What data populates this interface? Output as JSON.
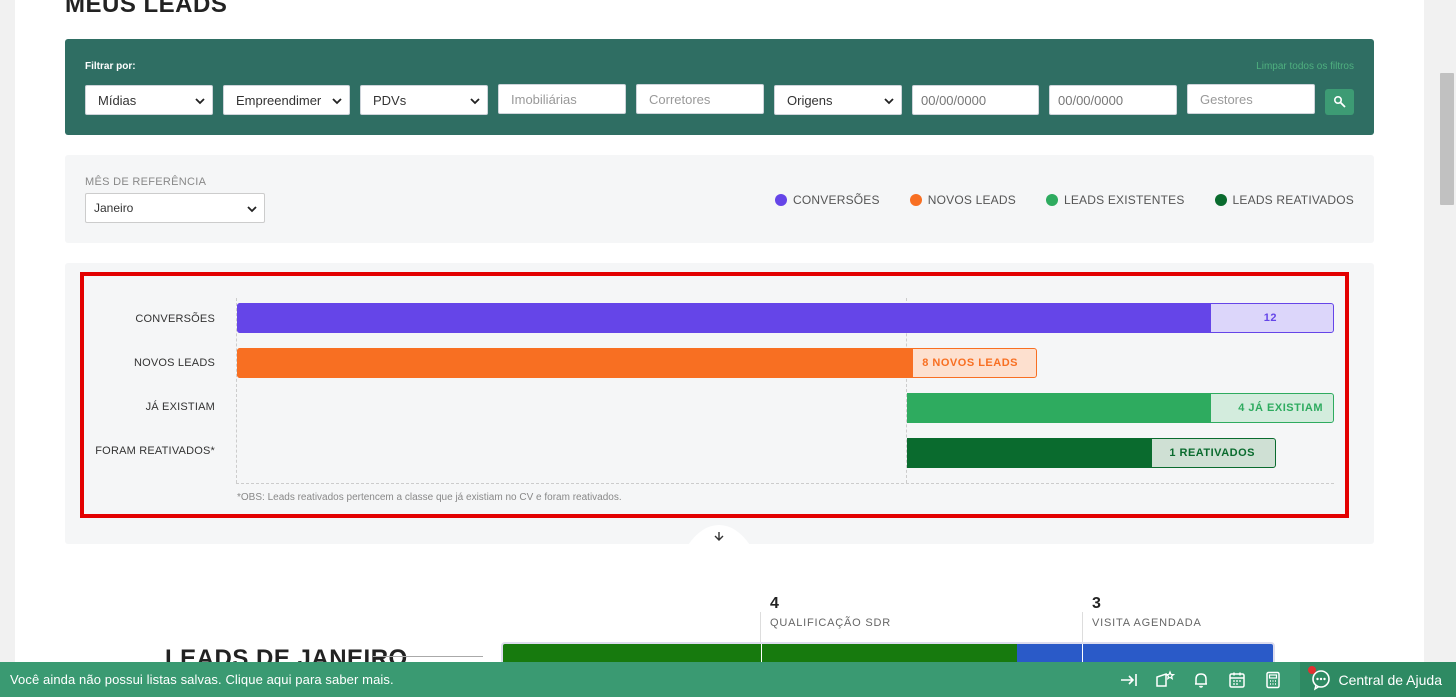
{
  "page": {
    "title": "MEUS LEADS"
  },
  "filters": {
    "label": "Filtrar por:",
    "clear_label": "Limpar todos os filtros",
    "midias": "Mídias",
    "empreendimentos": "Empreendimer",
    "pdvs": "PDVs",
    "imobiliarias_placeholder": "Imobiliárias",
    "corretores_placeholder": "Corretores",
    "origens": "Origens",
    "date_start_placeholder": "00/00/0000",
    "date_end_placeholder": "00/00/0000",
    "gestores_placeholder": "Gestores"
  },
  "reference": {
    "label": "MÊS DE REFERÊNCIA",
    "month": "Janeiro"
  },
  "legend": [
    {
      "label": "CONVERSÕES",
      "color": "#6545e8"
    },
    {
      "label": "NOVOS LEADS",
      "color": "#f86f22"
    },
    {
      "label": "LEADS EXISTENTES",
      "color": "#2eab5f"
    },
    {
      "label": "LEADS REATIVADOS",
      "color": "#0a6b2e"
    }
  ],
  "chart_data": {
    "type": "bar",
    "categories": [
      "CONVERSÕES",
      "NOVOS LEADS",
      "JÁ EXISTIAM",
      "FORAM REATIVADOS*"
    ],
    "values": [
      12,
      8,
      4,
      1
    ],
    "value_labels": [
      "12",
      "8 NOVOS LEADS",
      "4 JÁ EXISTIAM",
      "1 REATIVADOS"
    ],
    "colors": [
      "#6545e8",
      "#f86f22",
      "#2eab5f",
      "#0a6b2e"
    ],
    "note": "*OBS: Leads reativados pertencem a classe que já existiam no CV e foram reativados."
  },
  "leads_section": {
    "title": "LEADS DE JANEIRO",
    "stages": [
      {
        "count": "4",
        "label": "QUALIFICAÇÃO SDR"
      },
      {
        "count": "3",
        "label": "VISITA AGENDADA"
      }
    ]
  },
  "statusbar": {
    "message": "Você ainda não possui listas salvas. Clique aqui para saber mais.",
    "help_label": "Central de Ajuda"
  }
}
